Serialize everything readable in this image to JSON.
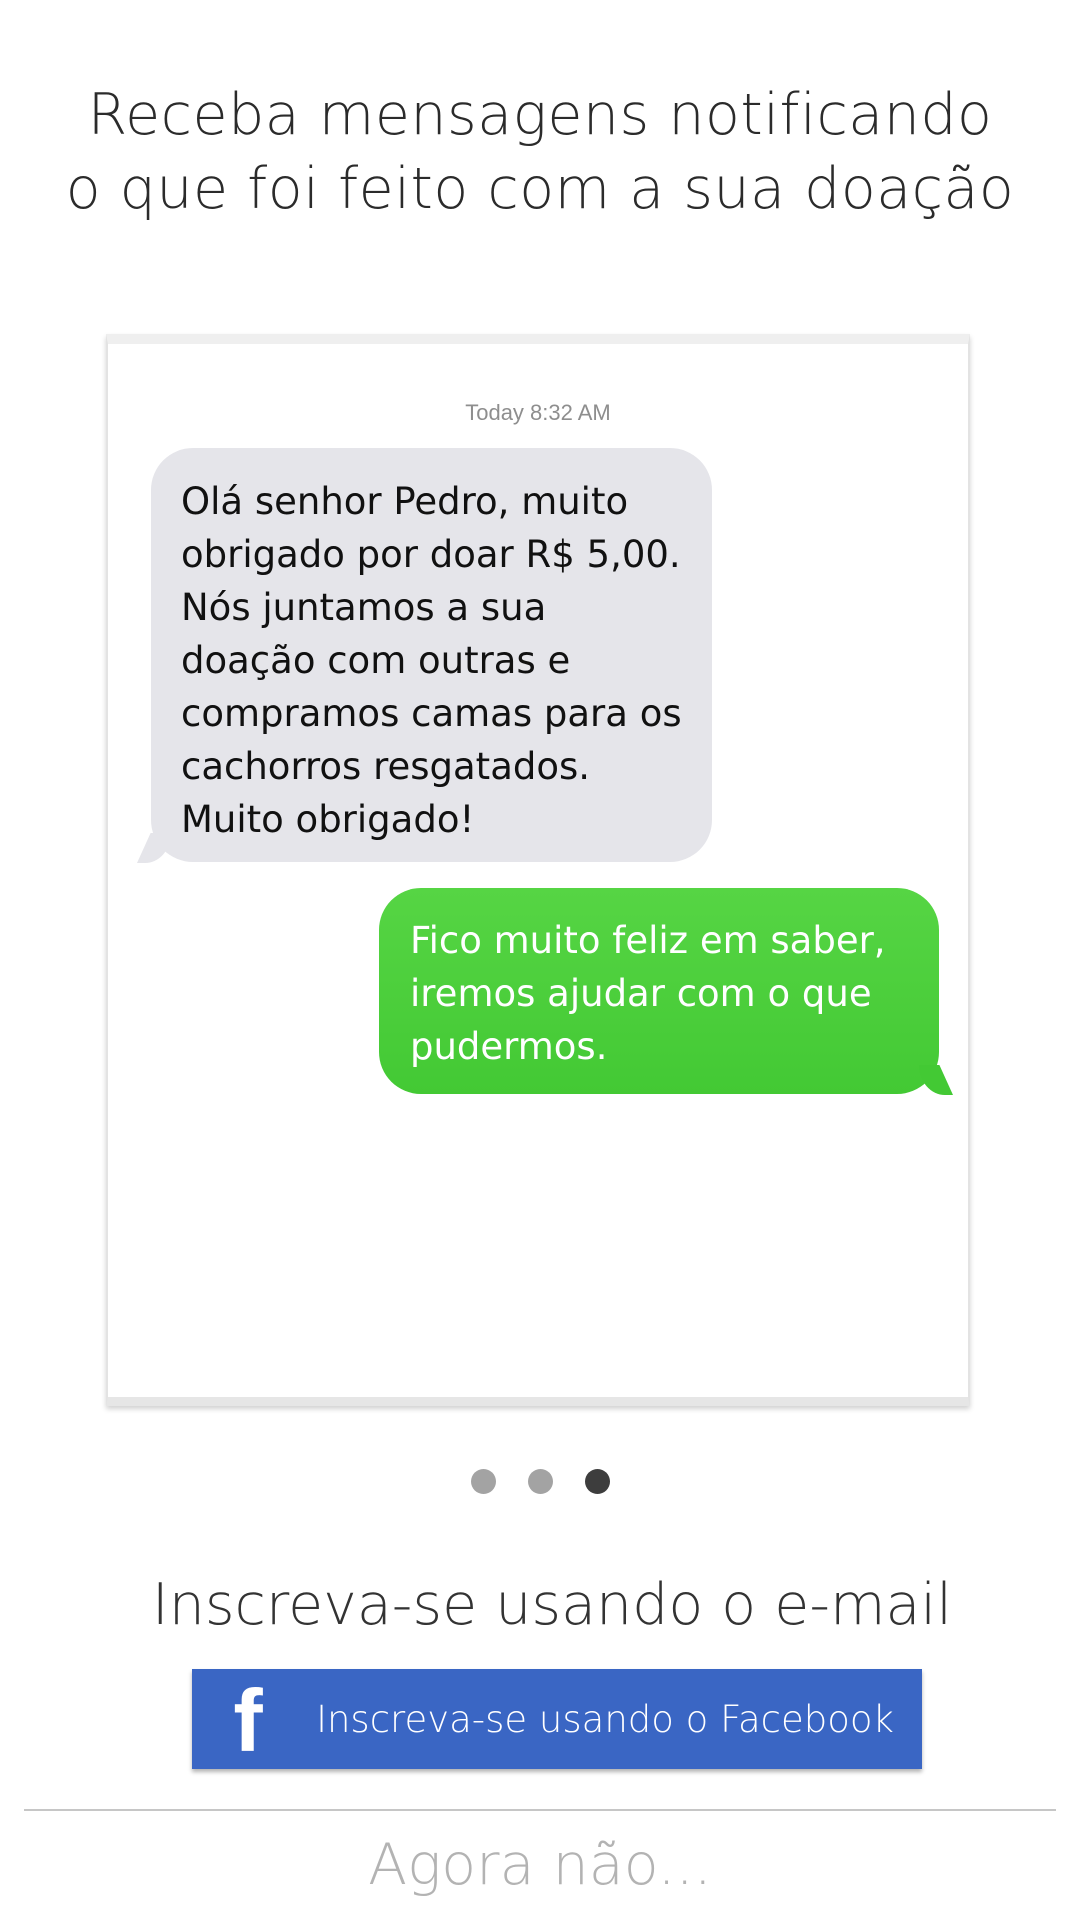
{
  "headline": {
    "line1": "Receba mensagens notificando",
    "line2": "o que foi feito com a sua doação"
  },
  "conversation": {
    "timestamp": "Today 8:32 AM",
    "messages": [
      {
        "direction": "incoming",
        "color": "#e5e5ea",
        "text": "Olá senhor Pedro, muito obrigado por doar R$ 5,00. Nós juntamos a sua doação com outras e compramos camas para os cachorros resgatados. Muito obrigado!"
      },
      {
        "direction": "outgoing",
        "color": "#4cd137",
        "text": "Fico muito feliz em saber, iremos ajudar com o que pudermos."
      }
    ]
  },
  "pager": {
    "total": 3,
    "active_index": 2
  },
  "signup": {
    "email_label": "Inscreva-se usando o e-mail",
    "facebook_label": "Inscreva-se usando o Facebook",
    "facebook_icon": "facebook-icon",
    "facebook_color": "#3a66c4",
    "skip_label": "Agora não..."
  }
}
